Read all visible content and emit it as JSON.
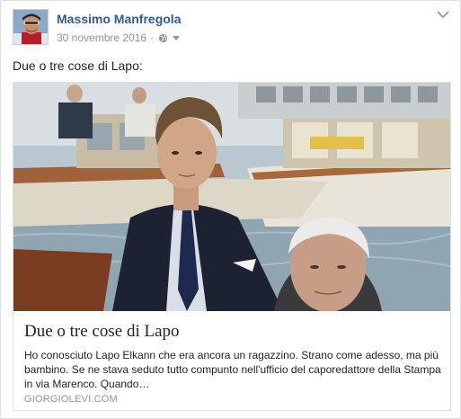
{
  "post": {
    "author": "Massimo Manfregola",
    "date": "30 novembre 2016",
    "separator": "·",
    "privacy_icon": "globe-icon",
    "menu_icon": "chevron-down-icon",
    "text": "Due o tre cose di Lapo:"
  },
  "link_preview": {
    "title": "Due o tre cose di Lapo",
    "description": "Ho conosciuto Lapo Elkann che era ancora un ragazzino. Strano come adesso, ma più bambino. Se ne stava seduto tutto compunto nell'ufficio del caporedattore della Stampa in via Marenco. Quando…",
    "domain": "GIORGIOLEVI.COM"
  },
  "colors": {
    "author_link": "#365899",
    "meta_text": "#90949c",
    "card_border": "#dddfe2"
  }
}
